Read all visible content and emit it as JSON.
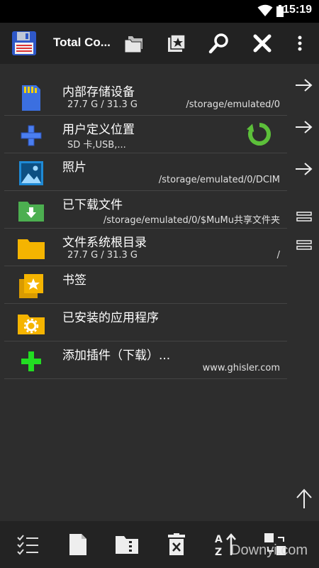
{
  "status": {
    "time": "15:19"
  },
  "toolbar": {
    "title": "Total Co...",
    "buttons": [
      "folders-icon",
      "bookmark-icon",
      "search-icon",
      "close-icon",
      "more-vert-icon"
    ]
  },
  "items": [
    {
      "label": "内部存储设备",
      "size": "27.7 G / 31.3 G",
      "path": "/storage/emulated/0",
      "icon": "sdcard-icon"
    },
    {
      "label": "用户定义位置",
      "size": "SD 卡,USB,...",
      "path": "",
      "icon": "plus-blue-icon"
    },
    {
      "label": "照片",
      "size": "",
      "path": "/storage/emulated/0/DCIM",
      "icon": "photo-icon"
    },
    {
      "label": "已下载文件",
      "size": "",
      "path": "/storage/emulated/0/$MuMu共享文件夹",
      "icon": "download-folder-icon"
    },
    {
      "label": "文件系统根目录",
      "size": "27.7 G / 31.3 G",
      "path": "/",
      "icon": "folder-icon"
    },
    {
      "label": "书签",
      "size": "",
      "path": "",
      "icon": "bookmark-folder-icon"
    },
    {
      "label": "已安装的应用程序",
      "size": "",
      "path": "",
      "icon": "apps-folder-icon"
    },
    {
      "label": "添加插件（下载）...",
      "size": "",
      "path": "www.ghisler.com",
      "icon": "plus-green-icon"
    }
  ],
  "side_buttons": [
    "arrow-right-icon",
    "arrow-right-icon",
    "arrow-right-icon",
    "equals-icon",
    "equals-icon"
  ],
  "bottom_bar": {
    "buttons": [
      "select-list-icon",
      "new-file-icon",
      "zip-folder-icon",
      "delete-icon",
      "sort-icon",
      "swap-icon"
    ],
    "watermark": "Downyi.com"
  },
  "colors": {
    "toolbar": "#222222",
    "content": "#2d2d2d",
    "folder_yellow": "#f5b400",
    "accent_green": "#5cbf3a",
    "accent_blue": "#3b6fe0"
  }
}
